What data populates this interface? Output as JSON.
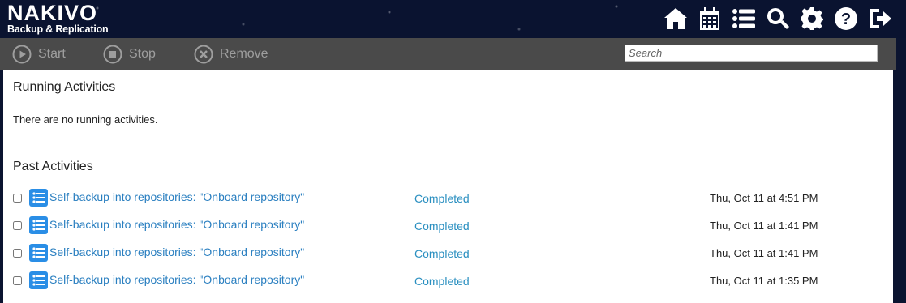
{
  "brand": {
    "name": "NAKIVO",
    "tagline": "Backup & Replication"
  },
  "topnav": [
    {
      "icon": "home-icon"
    },
    {
      "icon": "calendar-icon"
    },
    {
      "icon": "list-icon"
    },
    {
      "icon": "search-icon"
    },
    {
      "icon": "gear-icon"
    },
    {
      "icon": "help-icon"
    },
    {
      "icon": "logout-icon"
    }
  ],
  "toolbar": {
    "start_label": "Start",
    "stop_label": "Stop",
    "remove_label": "Remove",
    "search_placeholder": "Search"
  },
  "running": {
    "title": "Running Activities",
    "empty_message": "There are no running activities."
  },
  "past": {
    "title": "Past Activities",
    "items": [
      {
        "name": "Self-backup into repositories: \"Onboard repository\"",
        "status": "Completed",
        "time": "Thu, Oct 11 at 4:51 PM"
      },
      {
        "name": "Self-backup into repositories: \"Onboard repository\"",
        "status": "Completed",
        "time": "Thu, Oct 11 at 1:41 PM"
      },
      {
        "name": "Self-backup into repositories: \"Onboard repository\"",
        "status": "Completed",
        "time": "Thu, Oct 11 at 1:41 PM"
      },
      {
        "name": "Self-backup into repositories: \"Onboard repository\"",
        "status": "Completed",
        "time": "Thu, Oct 11 at 1:35 PM"
      }
    ]
  },
  "colors": {
    "header_bg": "#0a1330",
    "toolbar_bg": "#4a4a4a",
    "link": "#2a7fc0",
    "task_icon": "#2a8ee6"
  }
}
